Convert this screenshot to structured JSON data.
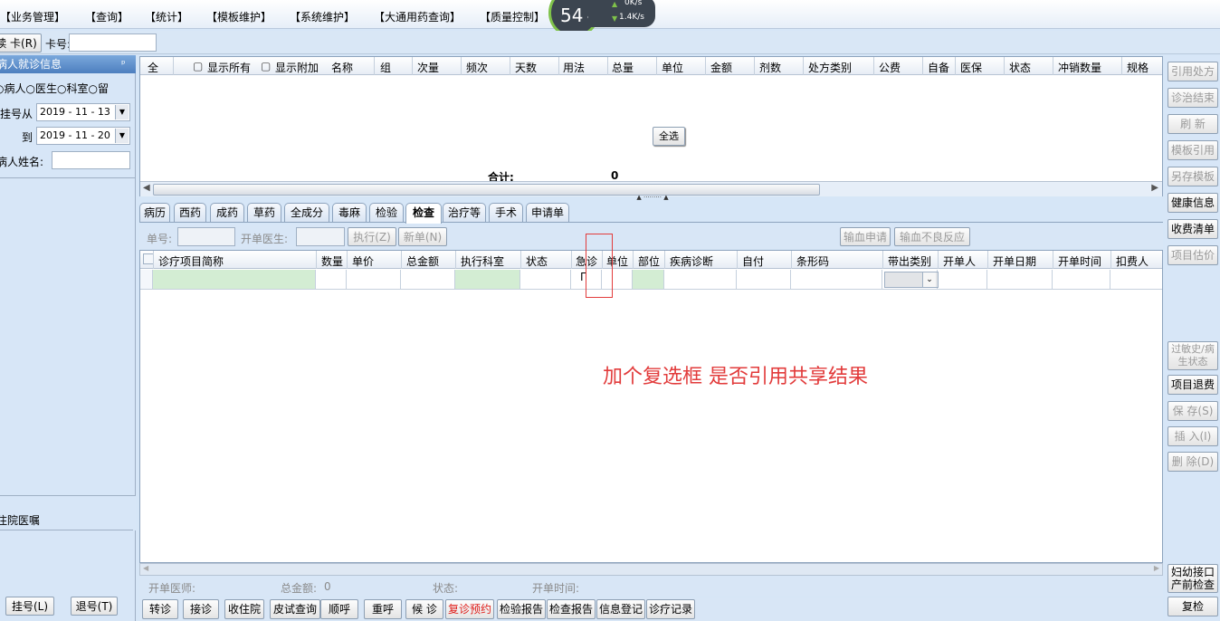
{
  "menubar": {
    "items": [
      "【业务管理】",
      "【查询】",
      "【统计】",
      "【模板维护】",
      "【系统维护】",
      "【大通用药查询】",
      "【质量控制】"
    ],
    "gauge_value": "54",
    "gauge_unit": "%",
    "net_up": "0K/s",
    "net_down": "1.4K/s"
  },
  "toolbar2": {
    "card_button": "读 卡(R)",
    "card_label": "卡号:",
    "card_value": ""
  },
  "leftpanel": {
    "header": "病人就诊信息",
    "pin": "ꟼ",
    "radios": [
      "病人",
      "医生",
      "科室",
      "留"
    ],
    "from_label": "挂号从",
    "from_date": "2019 - 11 - 13",
    "to_label": "到",
    "to_date": "2019 - 11 - 20",
    "name_label": "病人姓名:",
    "name_value": "",
    "section2_header": "住院医嘱",
    "register_button": "挂号(L)",
    "unregister_button": "退号(T)"
  },
  "topgrid": {
    "columns": [
      "全",
      "显示所有",
      "显示附加",
      "名称",
      "组",
      "次量",
      "频次",
      "天数",
      "用法",
      "总量",
      "单位",
      "金额",
      "剂数",
      "处方类别",
      "公费",
      "自备",
      "医保",
      "状态",
      "冲销数量",
      "规格"
    ],
    "select_all_button": "全选",
    "total_label": "合计:",
    "total_value": "0"
  },
  "tabs": [
    "病历",
    "西药",
    "成药",
    "草药",
    "全成分",
    "毒麻",
    "检验",
    "检查",
    "治疗等",
    "手术",
    "申请单"
  ],
  "active_tab": "检查",
  "formrow": {
    "order_no_label": "单号:",
    "order_no_value": "",
    "doctor_label": "开单医生:",
    "doctor_value": "",
    "execute_button": "执行(Z)",
    "new_button": "新单(N)",
    "transfusion_button": "输血申请",
    "adverse_button": "输血不良反应"
  },
  "grid2": {
    "columns": [
      "诊疗项目简称",
      "数量",
      "单价",
      "总金额",
      "执行科室",
      "状态",
      "急诊",
      "单位",
      "部位",
      "疾病诊断",
      "自付",
      "条形码",
      "带出类别",
      "开单人",
      "开单日期",
      "开单时间",
      "扣费人"
    ]
  },
  "annotation": {
    "text": "加个复选框 是否引用共享结果",
    "color": "#e23b3b"
  },
  "statusrow": {
    "doctor_label": "开单医师:",
    "amount_label": "总金额:",
    "amount_value": "0",
    "status_label": "状态:",
    "time_label": "开单时间:"
  },
  "bottombar": {
    "buttons": [
      "转诊",
      "接诊",
      "收住院",
      "皮试查询",
      "顺呼",
      "重呼",
      "候 诊",
      "复诊预约",
      "检验报告",
      "检查报告",
      "信息登记",
      "诊疗记录"
    ],
    "highlight_color": "#e0201c"
  },
  "rightpanel": {
    "buttons": [
      "引用处方",
      "诊治结束",
      "刷 新",
      "模板引用",
      "另存模板",
      "健康信息",
      "收费清单",
      "项目估价"
    ],
    "mid_buttons": [
      "过敏史/病生状态",
      "项目退费",
      "保 存(S)",
      "插 入(I)",
      "删 除(D)"
    ],
    "bottom_button_1": "妇幼接口产前检查",
    "bottom_button_2": "复检"
  }
}
